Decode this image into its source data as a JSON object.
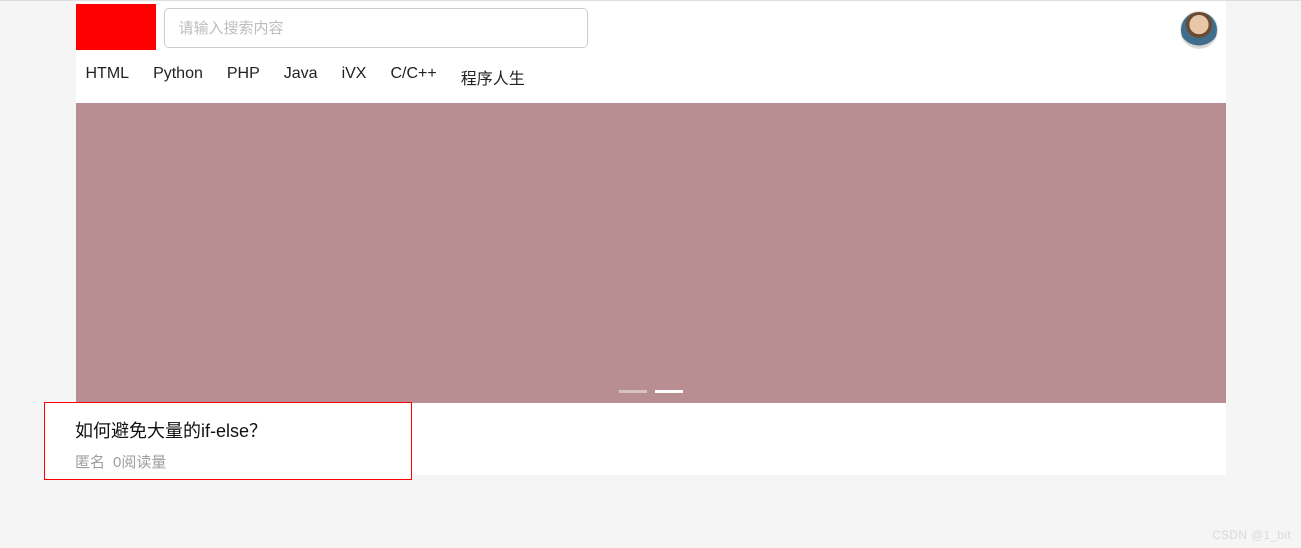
{
  "header": {
    "search_placeholder": "请输入搜索内容"
  },
  "nav": {
    "items": [
      "HTML",
      "Python",
      "PHP",
      "Java",
      "iVX",
      "C/C++",
      "程序人生"
    ]
  },
  "carousel": {
    "active_index": 1,
    "count": 2
  },
  "article": {
    "title": "如何避免大量的if-else？",
    "author": "匿名",
    "views_label": "0阅读量"
  },
  "watermark": "CSDN @1_bit"
}
